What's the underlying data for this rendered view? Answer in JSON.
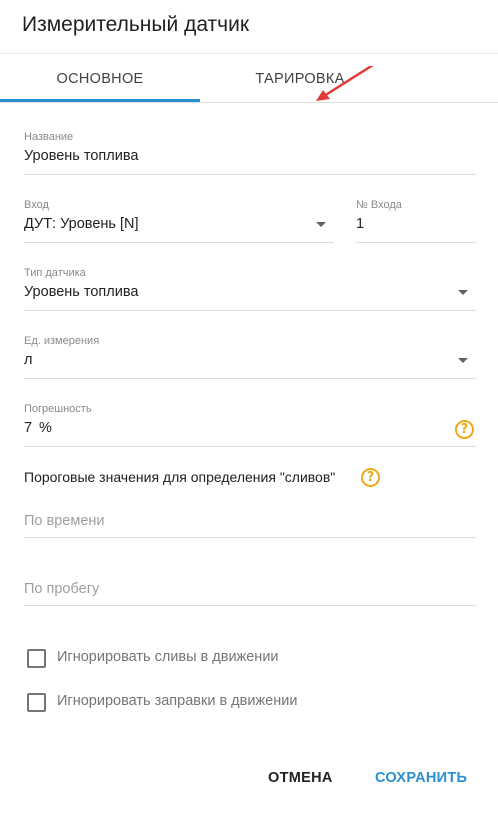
{
  "dialog": {
    "title": "Измерительный датчик"
  },
  "tabs": [
    {
      "label": "Основное",
      "active": true
    },
    {
      "label": "Тарировка",
      "active": false
    }
  ],
  "colors": {
    "accent": "#2a8fd0",
    "help": "#f0a91b",
    "arrow": "#e53935"
  },
  "form": {
    "name": {
      "label": "Название",
      "value": "Уровень топлива"
    },
    "input": {
      "label": "Вход",
      "value": "ДУТ: Уровень [N]"
    },
    "input_number": {
      "label": "№ Входа",
      "value": "1"
    },
    "sensor_type": {
      "label": "Тип датчика",
      "value": "Уровень топлива"
    },
    "unit": {
      "label": "Ед. измерения",
      "value": "л"
    },
    "error": {
      "label": "Погрешность",
      "value": "7",
      "suffix": "%"
    },
    "threshold_title": "Пороговые значения для определения \"сливов\"",
    "by_time": {
      "placeholder": "По времени"
    },
    "by_mileage": {
      "placeholder": "По пробегу"
    },
    "ignore_drains": {
      "label": "Игнорировать сливы в движении",
      "checked": false
    },
    "ignore_fills": {
      "label": "Игнорировать заправки в движении",
      "checked": false
    }
  },
  "actions": {
    "cancel": "Отмена",
    "save": "Сохранить"
  },
  "icons": {
    "help": "help-circle-icon",
    "dropdown": "caret-down-icon",
    "arrow": "red-arrow-icon"
  }
}
